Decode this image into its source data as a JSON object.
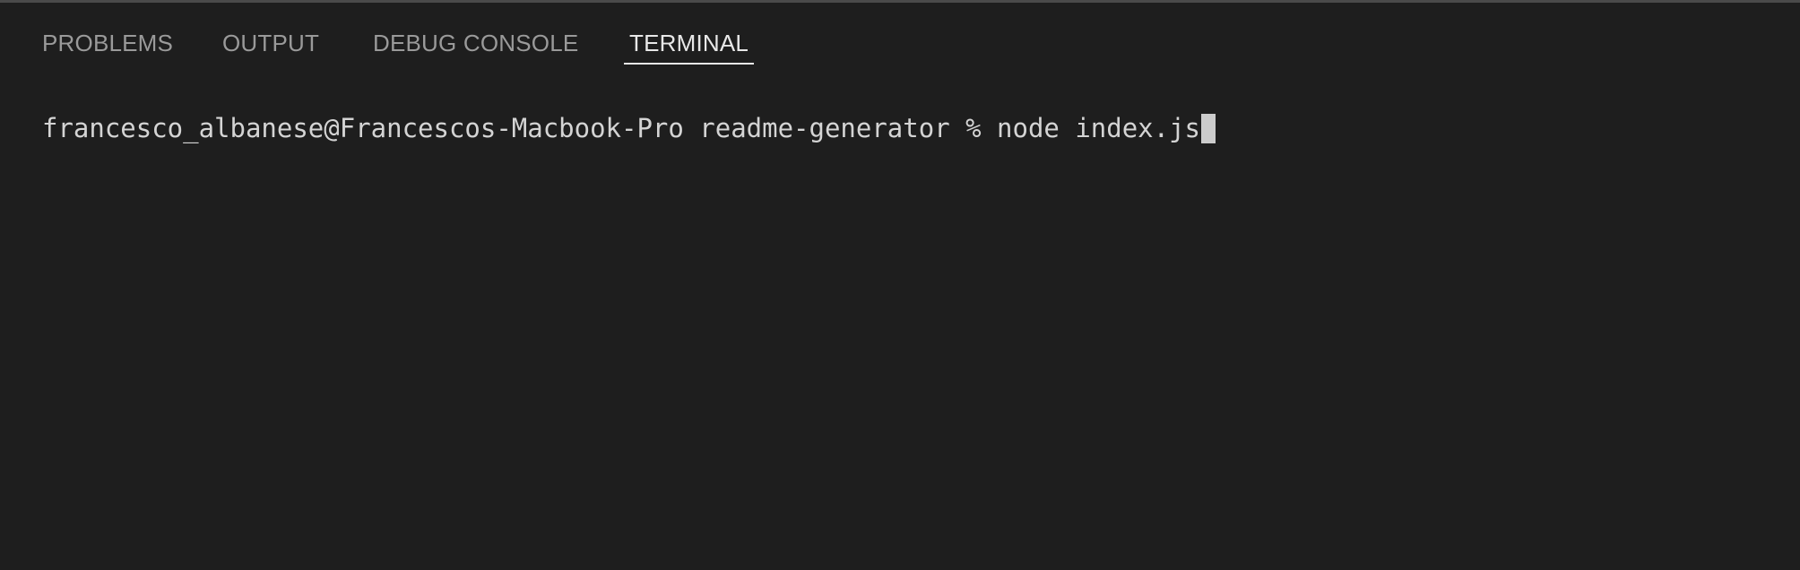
{
  "panel": {
    "tabs": [
      {
        "label": "PROBLEMS"
      },
      {
        "label": "OUTPUT"
      },
      {
        "label": "DEBUG CONSOLE"
      },
      {
        "label": "TERMINAL"
      }
    ],
    "active_tab": "TERMINAL"
  },
  "terminal": {
    "prompt": "francesco_albanese@Francescos-Macbook-Pro readme-generator % ",
    "command": "node index.js"
  },
  "colors": {
    "background": "#1e1e1e",
    "tab_inactive": "#9a9a9a",
    "tab_active": "#e8e8e8",
    "terminal_text": "#d4d4d4",
    "cursor": "#cccccc"
  }
}
